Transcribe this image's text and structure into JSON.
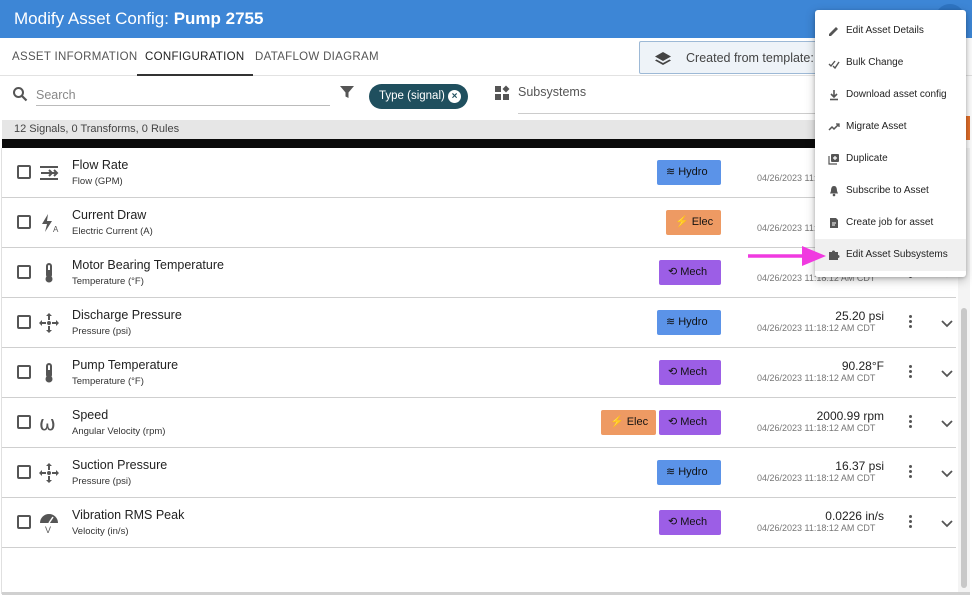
{
  "header": {
    "title_prefix": "Modify Asset Config: ",
    "title_asset": "Pump 2755"
  },
  "tabs": [
    {
      "label": "ASSET INFORMATION",
      "active": false
    },
    {
      "label": "CONFIGURATION",
      "active": true
    },
    {
      "label": "DATAFLOW DIAGRAM",
      "active": false
    }
  ],
  "template": {
    "text": "Created from template:"
  },
  "filters": {
    "search_placeholder": "Search",
    "chip_label": "Type (signal)",
    "subsystems_label": "Subsystems"
  },
  "summary": "12 Signals, 0 Transforms, 0 Rules",
  "colors": {
    "header": "#3d86d6",
    "hydro": "#5b93e8",
    "elec": "#ee9a63",
    "mech": "#9c5ee6",
    "chip": "#1f4f5e",
    "arrow": "#f03ae0"
  },
  "rows": [
    {
      "name": "Flow Rate",
      "subtitle": "Flow (GPM)",
      "icon": "flow-arrows-icon",
      "tags": [
        {
          "label": "Hydro",
          "kind": "hydro"
        }
      ],
      "value": "",
      "timestamp": "04/26/2023 11:18:12 AM CDT"
    },
    {
      "name": "Current Draw",
      "subtitle": "Electric Current (A)",
      "icon": "current-bolt-icon",
      "tags": [
        {
          "label": "Elec",
          "kind": "elec"
        }
      ],
      "value": "",
      "timestamp": "04/26/2023 11:18:12 AM CDT"
    },
    {
      "name": "Motor Bearing Temperature",
      "subtitle": "Temperature (°F)",
      "icon": "thermometer-icon",
      "tags": [
        {
          "label": "Mech",
          "kind": "mech"
        }
      ],
      "value": "",
      "timestamp": "04/26/2023 11:18:12 AM CDT"
    },
    {
      "name": "Discharge Pressure",
      "subtitle": "Pressure (psi)",
      "icon": "pressure-arrows-icon",
      "tags": [
        {
          "label": "Hydro",
          "kind": "hydro"
        }
      ],
      "value": "25.20 psi",
      "timestamp": "04/26/2023 11:18:12 AM CDT"
    },
    {
      "name": "Pump Temperature",
      "subtitle": "Temperature (°F)",
      "icon": "thermometer-icon",
      "tags": [
        {
          "label": "Mech",
          "kind": "mech"
        }
      ],
      "value": "90.28°F",
      "timestamp": "04/26/2023 11:18:12 AM CDT"
    },
    {
      "name": "Speed",
      "subtitle": "Angular Velocity (rpm)",
      "icon": "omega-icon",
      "tags": [
        {
          "label": "Elec",
          "kind": "elec"
        },
        {
          "label": "Mech",
          "kind": "mech"
        }
      ],
      "value": "2000.99 rpm",
      "timestamp": "04/26/2023 11:18:12 AM CDT"
    },
    {
      "name": "Suction Pressure",
      "subtitle": "Pressure (psi)",
      "icon": "pressure-arrows-icon",
      "tags": [
        {
          "label": "Hydro",
          "kind": "hydro"
        }
      ],
      "value": "16.37 psi",
      "timestamp": "04/26/2023 11:18:12 AM CDT"
    },
    {
      "name": "Vibration RMS Peak",
      "subtitle": "Velocity (in/s)",
      "icon": "gauge-icon",
      "tags": [
        {
          "label": "Mech",
          "kind": "mech"
        }
      ],
      "value": "0.0226 in/s",
      "timestamp": "04/26/2023 11:18:12 AM CDT"
    }
  ],
  "menu": [
    {
      "label": "Edit Asset Details",
      "icon": "pencil-icon",
      "highlighted": false
    },
    {
      "label": "Bulk Change",
      "icon": "bulk-change-icon",
      "highlighted": false
    },
    {
      "label": "Download asset config",
      "icon": "download-icon",
      "highlighted": false
    },
    {
      "label": "Migrate Asset",
      "icon": "trend-icon",
      "highlighted": false
    },
    {
      "label": "Duplicate",
      "icon": "duplicate-icon",
      "highlighted": false
    },
    {
      "label": "Subscribe to Asset",
      "icon": "bell-icon",
      "highlighted": false
    },
    {
      "label": "Create job for asset",
      "icon": "job-icon",
      "highlighted": false
    },
    {
      "label": "Edit Asset Subsystems",
      "icon": "puzzle-icon",
      "highlighted": true
    }
  ]
}
